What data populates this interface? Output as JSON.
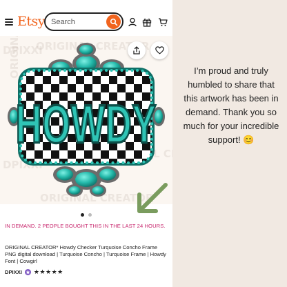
{
  "header": {
    "logo": "Etsy",
    "search_placeholder": "Search"
  },
  "listing": {
    "watermark_text": "ORIGINAL CREATOR",
    "watermark_brand": "DPIXXI",
    "artwork_text": "HOWDY",
    "carousel": {
      "total": 2,
      "active_index": 0
    },
    "demand_notice": "IN DEMAND. 2 PEOPLE BOUGHT THIS IN THE LAST 24 HOURS.",
    "title": "ORIGINAL CREATOR* Howdy Checker Turquoise Concho Frame PNG digital download | Turquoise Concho | Turquoise Frame | Howdy Font | Cowgirl",
    "shop_name": "DPIXXI",
    "rating_stars": "★★★★★",
    "rating": 5
  },
  "side_message": "I’m proud and truly humbled to share that this artwork has been in demand. Thank you so much for your incredible support! 😊",
  "colors": {
    "etsy_orange": "#f1641e",
    "turquoise": "#2fc4b5",
    "demand_pink": "#c7246b",
    "arrow_green": "#7a9c5e",
    "background": "#f1e9e2"
  },
  "icons": [
    "menu-icon",
    "search-icon",
    "user-icon",
    "gift-icon",
    "cart-icon",
    "share-icon",
    "heart-icon",
    "star-seller-icon",
    "arrow-icon"
  ]
}
